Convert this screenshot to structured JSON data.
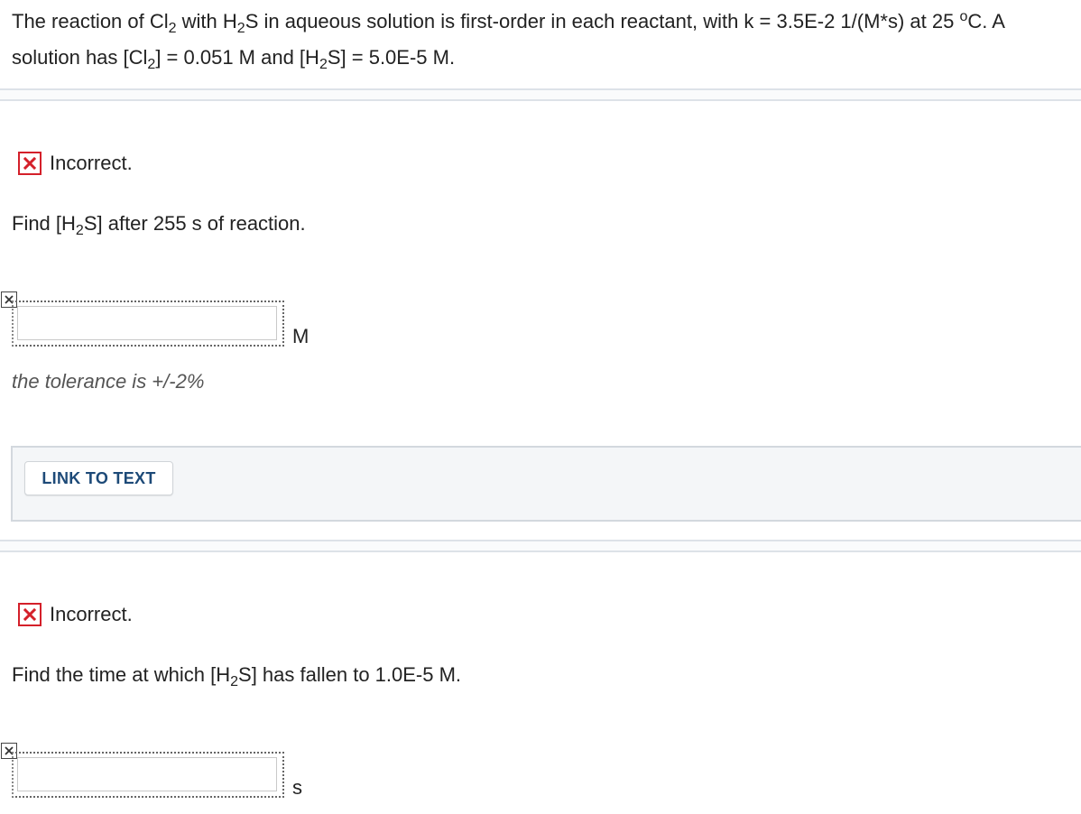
{
  "problem": {
    "p1": "The reaction of Cl",
    "s1": "2",
    "p2": " with H",
    "s2": "2",
    "p3": "S in aqueous solution is first-order in each reactant, with k = 3.5E-2 1/(M*s) at 25 ",
    "sup": "o",
    "p4": "C. A solution has [Cl",
    "s3": "2",
    "p5": "] = 0.051 M and [H",
    "s4": "2",
    "p6": "S] = 5.0E-5 M."
  },
  "part1": {
    "status": "Incorrect.",
    "q1": "Find [H",
    "qs": "2",
    "q2": "S] after 255 s of reaction.",
    "unit": "M",
    "tolerance": "the tolerance is +/-2%",
    "value": ""
  },
  "link_text_button": "LINK TO TEXT",
  "part2": {
    "status": "Incorrect.",
    "q1": "Find the time at which [H",
    "qs": "2",
    "q2": "S] has fallen to 1.0E-5 M.",
    "unit": "s",
    "value": ""
  },
  "colors": {
    "incorrect_red": "#d4202a",
    "link_blue": "#1d4a78",
    "panel_bg": "#f4f6f8"
  },
  "icons": {
    "status": "x-box-icon",
    "answer_mark": "x-mark-icon"
  }
}
